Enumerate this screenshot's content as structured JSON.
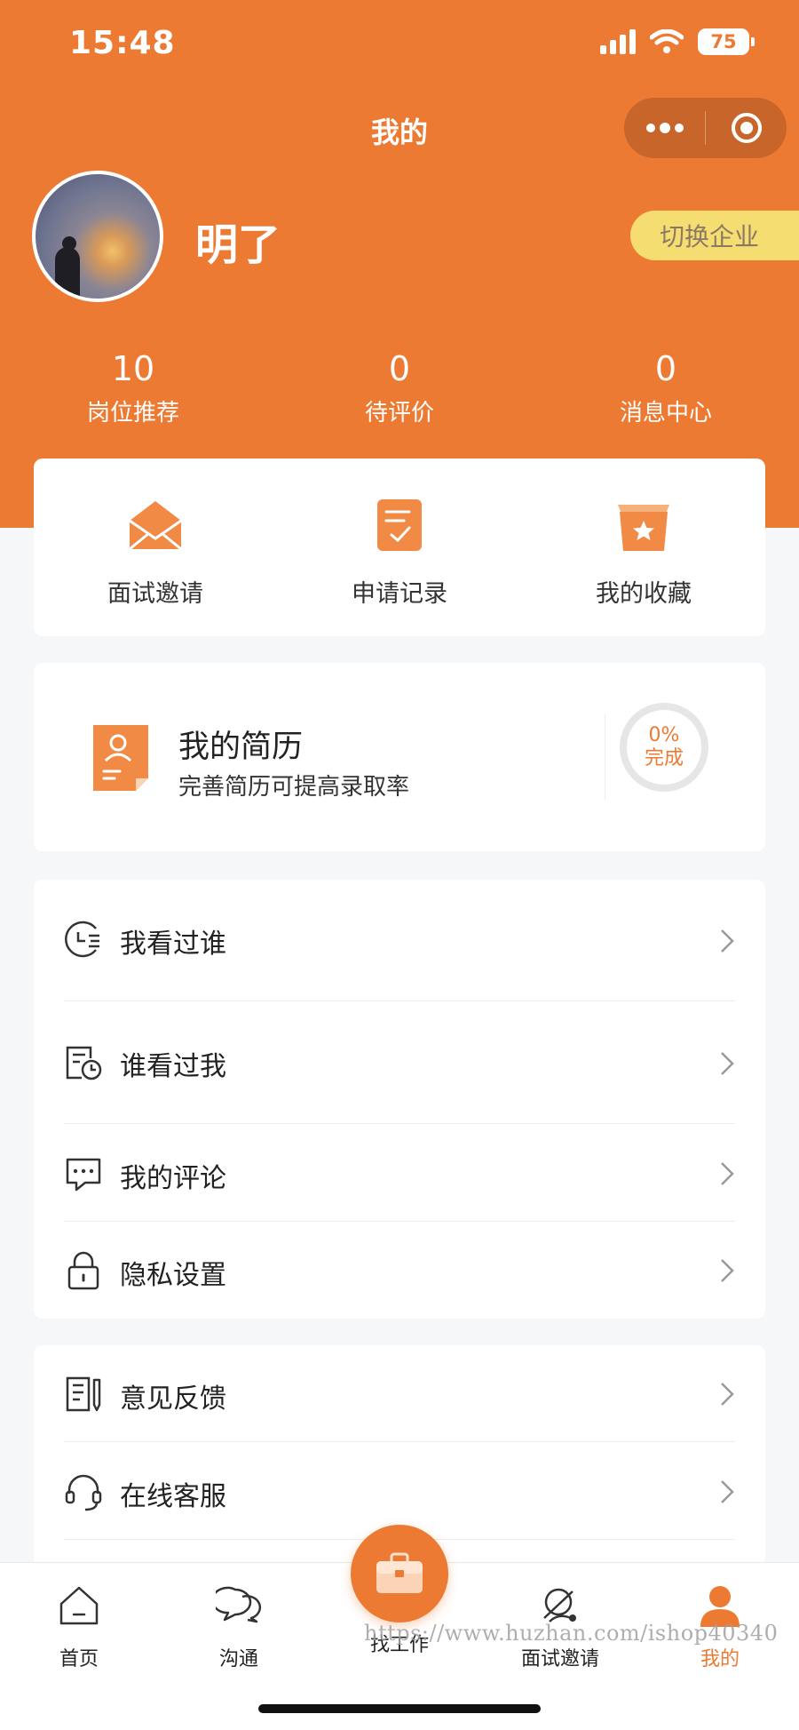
{
  "status_bar": {
    "time": "15:48",
    "battery": "75"
  },
  "nav": {
    "title": "我的"
  },
  "profile": {
    "username": "明了",
    "switch_label": "切换企业"
  },
  "stats": [
    {
      "value": "10",
      "label": "岗位推荐"
    },
    {
      "value": "0",
      "label": "待评价"
    },
    {
      "value": "0",
      "label": "消息中心"
    }
  ],
  "quick_actions": [
    {
      "label": "面试邀请",
      "icon": "envelope-icon"
    },
    {
      "label": "申请记录",
      "icon": "application-record-icon"
    },
    {
      "label": "我的收藏",
      "icon": "favorites-star-icon"
    }
  ],
  "resume": {
    "title": "我的简历",
    "subtitle": "完善简历可提高录取率",
    "progress_value": 0,
    "progress_percent": "0%",
    "progress_label": "完成"
  },
  "menu_group_1": [
    {
      "label": "我看过谁",
      "icon": "history-clock-icon"
    },
    {
      "label": "谁看过我",
      "icon": "viewed-me-icon"
    },
    {
      "label": "我的评论",
      "icon": "comment-icon"
    },
    {
      "label": "隐私设置",
      "icon": "lock-icon"
    }
  ],
  "menu_group_2": [
    {
      "label": "意见反馈",
      "icon": "feedback-icon"
    },
    {
      "label": "在线客服",
      "icon": "headset-icon"
    }
  ],
  "tabbar": {
    "items": [
      {
        "label": "首页",
        "icon": "home-icon"
      },
      {
        "label": "沟通",
        "icon": "chat-icon"
      },
      {
        "label": "找工作",
        "icon": "briefcase-icon"
      },
      {
        "label": "面试邀请",
        "icon": "interview-icon"
      },
      {
        "label": "我的",
        "icon": "user-icon"
      }
    ],
    "active_index": 4
  },
  "watermark": "https://www.huzhan.com/ishop40340",
  "colors": {
    "accent": "#ed7a32",
    "switch_bg": "#f5dd72",
    "background": "#f6f7f9"
  }
}
